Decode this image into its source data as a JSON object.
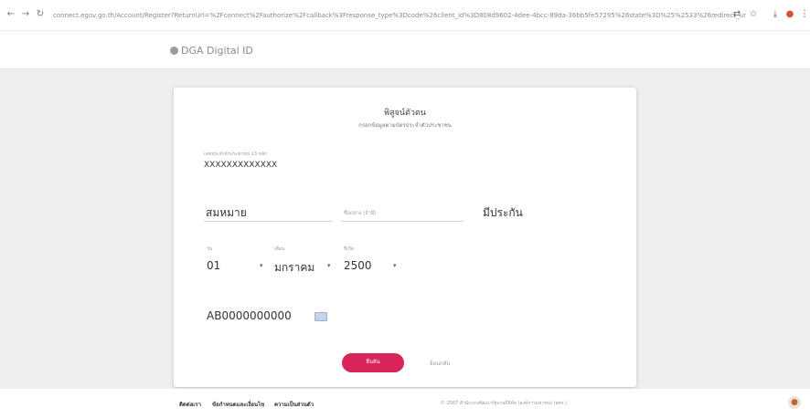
{
  "browser": {
    "back_icon": "arrow-left-icon",
    "forward_icon": "arrow-right-icon",
    "reload_icon": "reload-icon",
    "url": "connect.egov.go.th/Account/Register?ReturnUrl=%2Fconnect%2Fauthorize%2Fcallback%3Fresponse_type%3Dcode%26client_id%3D808d9602-4dee-4bcc-89da-36bb5fe57295%26state%3D%25%2533%26redirect_uri%3Dhttps%253A%252F%252Fenroll..."
  },
  "site": {
    "brand": "DGA Digital ID"
  },
  "card": {
    "title": "พิสูจน์ตัวตน",
    "subtitle": "กรอกข้อมูลตามบัตรประจำตัวประชาชน",
    "citizen_id": {
      "label": "เลขประจำตัวประชาชน 13 หลัก",
      "value": "XXXXXXXXXXXXX"
    },
    "first_name": {
      "value": "สมหมาย"
    },
    "middle_name": {
      "placeholder": "ชื่อกลาง (ถ้ามี)"
    },
    "last_name": {
      "value": "มีประกัน"
    },
    "birth_day": {
      "label": "วัน",
      "value": "01"
    },
    "birth_month": {
      "label": "เดือน",
      "value": "มกราคม"
    },
    "birth_year": {
      "label": "ปีเกิด",
      "value": "2500"
    },
    "laser_code": {
      "value": "AB0000000000"
    },
    "submit_label": "ยืนยัน",
    "back_label": "ย้อนกลับ"
  },
  "footer": {
    "links": [
      "ติดต่อเรา",
      "ข้อกำหนดและเงื่อนไข",
      "ความเป็นส่วนตัว"
    ],
    "copyright": "© 2567 สำนักงานพัฒนารัฐบาลดิจิทัล (องค์การมหาชน) (สพร.)"
  }
}
